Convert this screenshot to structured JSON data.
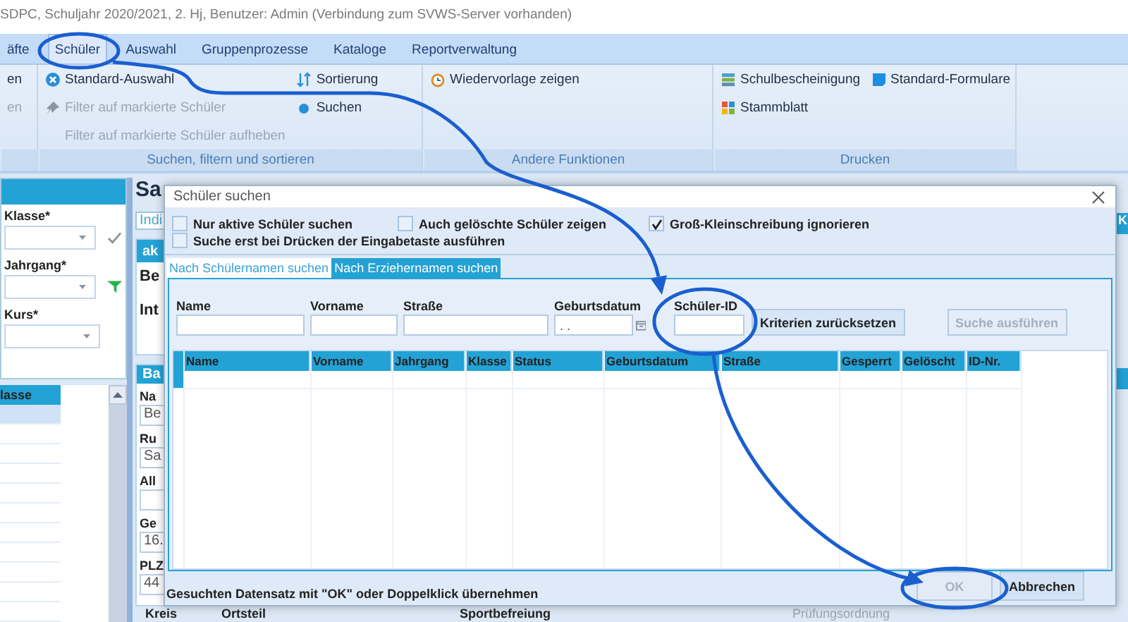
{
  "window": {
    "title": "SDPC, Schuljahr 2020/2021, 2. Hj, Benutzer: Admin (Verbindung zum SVWS-Server vorhanden)"
  },
  "menu": [
    {
      "label": "äfte",
      "selected": false
    },
    {
      "label": "Schüler",
      "selected": true
    },
    {
      "label": "Auswahl",
      "selected": false
    },
    {
      "label": "Gruppenprozesse",
      "selected": false
    },
    {
      "label": "Kataloge",
      "selected": false
    },
    {
      "label": "Reportverwaltung",
      "selected": false
    }
  ],
  "ribbon": [
    {
      "columns": [
        [
          {
            "label": "en",
            "disabled": false
          },
          {
            "label": "en",
            "disabled": true
          }
        ]
      ]
    },
    {
      "title": "Suchen, filtern und sortieren",
      "columns": [
        [
          {
            "label": "Standard-Auswahl",
            "disabled": false
          },
          {
            "label": "Filter auf markierte Schüler",
            "disabled": true
          },
          {
            "label": "Filter auf markierte Schüler aufheben",
            "disabled": true
          }
        ],
        [
          {
            "label": "Sortierung",
            "disabled": false
          },
          {
            "label": "Suchen",
            "disabled": false
          }
        ]
      ]
    },
    {
      "title": "Andere Funktionen",
      "columns": [
        [
          {
            "label": "Wiedervorlage zeigen",
            "disabled": false
          }
        ]
      ]
    },
    {
      "title": "Drucken",
      "columns": [
        [
          {
            "label": "Schulbescheinigung",
            "disabled": false
          },
          {
            "label": "Stammblatt",
            "disabled": false
          }
        ],
        [
          {
            "label": "Standard-Formulare",
            "disabled": false
          }
        ]
      ]
    }
  ],
  "filter_panel": {
    "filters": [
      {
        "label": "Klasse*",
        "kind": "check"
      },
      {
        "label": "Jahrgang*",
        "kind": "funnel"
      },
      {
        "label": "Kurs*",
        "kind": "plain"
      }
    ]
  },
  "student_list": {
    "column": "lasse",
    "rows": [
      {
        "selected": true
      },
      {
        "selected": false
      },
      {
        "selected": false
      },
      {
        "selected": false
      },
      {
        "selected": false
      },
      {
        "selected": false
      },
      {
        "selected": false
      },
      {
        "selected": false
      },
      {
        "selected": false
      },
      {
        "selected": false
      },
      {
        "selected": false
      }
    ]
  },
  "detail": {
    "title": "Sa",
    "tab": "Indi",
    "cards": [
      {
        "header": "ak",
        "items": [
          {
            "kind": "heading",
            "text": "Be"
          },
          {
            "kind": "heading",
            "text": "Int"
          }
        ]
      },
      {
        "header": "Ba",
        "items": [
          {
            "kind": "label",
            "text": "Na"
          },
          {
            "kind": "field",
            "text": "Be"
          },
          {
            "kind": "label",
            "text": "Ru"
          },
          {
            "kind": "field",
            "text": "Sa"
          },
          {
            "kind": "label",
            "text": "All"
          },
          {
            "kind": "field"
          },
          {
            "kind": "label",
            "text": "Ge"
          },
          {
            "kind": "field",
            "text": "16."
          },
          {
            "kind": "label",
            "text": "PLZ"
          },
          {
            "kind": "field",
            "text": "44"
          }
        ]
      }
    ],
    "side_tabs": [
      {
        "label": "K"
      }
    ],
    "footer": [
      {
        "text": "Kreis",
        "disabled": false
      },
      {
        "text": "Ortsteil",
        "disabled": false
      },
      {
        "text": "Sportbefreiung",
        "disabled": false
      },
      {
        "text": "Prüfungsordnung",
        "disabled": true
      }
    ]
  },
  "dialog": {
    "title": "Schüler suchen",
    "options": [
      {
        "label": "Nur aktive Schüler suchen",
        "checked": false
      },
      {
        "label": "Auch gelöschte Schüler zeigen",
        "checked": false
      },
      {
        "label": "Groß-Kleinschreibung ignorieren",
        "checked": true
      },
      {
        "label": "Suche erst bei Drücken der Eingabetaste ausführen",
        "checked": false
      }
    ],
    "tabs": [
      {
        "label": "Nach Schülernamen suchen",
        "selected": true
      },
      {
        "label": "Nach Erziehernamen suchen",
        "selected": false
      }
    ],
    "fields": [
      {
        "label": "Name",
        "kind": "text"
      },
      {
        "label": "Vorname",
        "kind": "text"
      },
      {
        "label": "Straße",
        "kind": "text"
      },
      {
        "label": "Geburtsdatum",
        "kind": "date",
        "value": ". ."
      },
      {
        "label": "Schüler-ID",
        "kind": "text"
      }
    ],
    "actions": [
      {
        "label": "Kriterien zurücksetzen",
        "disabled": false
      },
      {
        "label": "Suche ausführen",
        "disabled": true
      }
    ],
    "table": {
      "columns": [
        "Name",
        "Vorname",
        "Jahrgang",
        "Klasse",
        "Status",
        "Geburtsdatum",
        "Straße",
        "Gesperrt",
        "Gelöscht",
        "ID-Nr."
      ],
      "rows": [
        {
          "selected": true
        }
      ]
    },
    "hint": "Gesuchten Datensatz mit \"OK\" oder Doppelklick übernehmen",
    "buttons": [
      {
        "label": "OK",
        "disabled": true
      },
      {
        "label": "Abbrechen",
        "disabled": false
      }
    ]
  }
}
